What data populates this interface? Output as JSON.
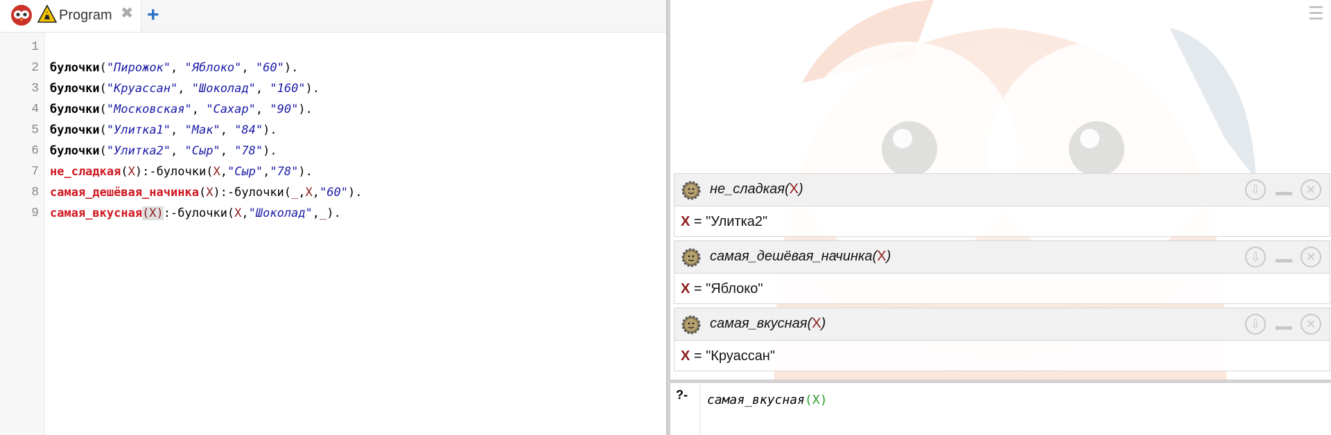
{
  "tab": {
    "title": "Program",
    "close": "✖",
    "new": "+"
  },
  "editor": {
    "line_numbers": [
      "1",
      "2",
      "3",
      "4",
      "5",
      "6",
      "7",
      "8",
      "9"
    ],
    "lines": [
      {
        "tokens": []
      },
      {
        "tokens": [
          {
            "t": "булочки",
            "c": "pr"
          },
          {
            "t": "(",
            "c": "pu"
          },
          {
            "t": "\"Пирожок\"",
            "c": "st"
          },
          {
            "t": ", ",
            "c": "pu"
          },
          {
            "t": "\"Яблоко\"",
            "c": "st"
          },
          {
            "t": ", ",
            "c": "pu"
          },
          {
            "t": "\"60\"",
            "c": "st"
          },
          {
            "t": ").",
            "c": "pu"
          }
        ]
      },
      {
        "tokens": [
          {
            "t": "булочки",
            "c": "pr"
          },
          {
            "t": "(",
            "c": "pu"
          },
          {
            "t": "\"Круассан\"",
            "c": "st"
          },
          {
            "t": ", ",
            "c": "pu"
          },
          {
            "t": "\"Шоколад\"",
            "c": "st"
          },
          {
            "t": ", ",
            "c": "pu"
          },
          {
            "t": "\"160\"",
            "c": "st"
          },
          {
            "t": ").",
            "c": "pu"
          }
        ]
      },
      {
        "tokens": [
          {
            "t": "булочки",
            "c": "pr"
          },
          {
            "t": "(",
            "c": "pu"
          },
          {
            "t": "\"Московская\"",
            "c": "st"
          },
          {
            "t": ", ",
            "c": "pu"
          },
          {
            "t": "\"Сахар\"",
            "c": "st"
          },
          {
            "t": ", ",
            "c": "pu"
          },
          {
            "t": "\"90\"",
            "c": "st"
          },
          {
            "t": ").",
            "c": "pu"
          }
        ]
      },
      {
        "tokens": [
          {
            "t": "булочки",
            "c": "pr"
          },
          {
            "t": "(",
            "c": "pu"
          },
          {
            "t": "\"Улитка1\"",
            "c": "st"
          },
          {
            "t": ", ",
            "c": "pu"
          },
          {
            "t": "\"Мак\"",
            "c": "st"
          },
          {
            "t": ", ",
            "c": "pu"
          },
          {
            "t": "\"84\"",
            "c": "st"
          },
          {
            "t": ").",
            "c": "pu"
          }
        ]
      },
      {
        "tokens": [
          {
            "t": "булочки",
            "c": "pr"
          },
          {
            "t": "(",
            "c": "pu"
          },
          {
            "t": "\"Улитка2\"",
            "c": "st"
          },
          {
            "t": ", ",
            "c": "pu"
          },
          {
            "t": "\"Сыр\"",
            "c": "st"
          },
          {
            "t": ", ",
            "c": "pu"
          },
          {
            "t": "\"78\"",
            "c": "st"
          },
          {
            "t": ").",
            "c": "pu"
          }
        ]
      },
      {
        "tokens": [
          {
            "t": "не_сладкая",
            "c": "hd"
          },
          {
            "t": "(",
            "c": "pu"
          },
          {
            "t": "X",
            "c": "va"
          },
          {
            "t": "):-булочки(",
            "c": "pu"
          },
          {
            "t": "X",
            "c": "va"
          },
          {
            "t": ",",
            "c": "pu"
          },
          {
            "t": "\"Сыр\"",
            "c": "st"
          },
          {
            "t": ",",
            "c": "pu"
          },
          {
            "t": "\"78\"",
            "c": "st"
          },
          {
            "t": ").",
            "c": "pu"
          }
        ]
      },
      {
        "tokens": [
          {
            "t": "самая_дешёвая_начинка",
            "c": "hd"
          },
          {
            "t": "(",
            "c": "pu"
          },
          {
            "t": "X",
            "c": "va"
          },
          {
            "t": "):-булочки(",
            "c": "pu"
          },
          {
            "t": "_",
            "c": "va"
          },
          {
            "t": ",",
            "c": "pu"
          },
          {
            "t": "X",
            "c": "va"
          },
          {
            "t": ",",
            "c": "pu"
          },
          {
            "t": "\"60\"",
            "c": "st"
          },
          {
            "t": ").",
            "c": "pu"
          }
        ]
      },
      {
        "tokens": [
          {
            "t": "самая_вкусная",
            "c": "hd"
          },
          {
            "t": "(X)",
            "c": "va hl"
          },
          {
            "t": ":-булочки(",
            "c": "pu"
          },
          {
            "t": "X",
            "c": "va"
          },
          {
            "t": ",",
            "c": "pu"
          },
          {
            "t": "\"Шоколад\"",
            "c": "st"
          },
          {
            "t": ",",
            "c": "pu"
          },
          {
            "t": "_",
            "c": "va"
          },
          {
            "t": ").",
            "c": "pu"
          }
        ]
      }
    ]
  },
  "results": [
    {
      "query_name": "не_сладкая",
      "query_open": "(",
      "query_var": "X",
      "query_close": ")",
      "res_var": "X",
      "res_eq": " = ",
      "res_value": "\"Улитка2\""
    },
    {
      "query_name": "самая_дешёвая_начинка",
      "query_open": "(",
      "query_var": "X",
      "query_close": ")",
      "res_var": "X",
      "res_eq": " = ",
      "res_value": "\"Яблоко\""
    },
    {
      "query_name": "самая_вкусная",
      "query_open": "(",
      "query_var": "X",
      "query_close": ")",
      "res_var": "X",
      "res_eq": " = ",
      "res_value": "\"Круассан\""
    }
  ],
  "query": {
    "prompt": "?-",
    "name": "самая_вкусная",
    "open": "(",
    "var": "X",
    "close": ")"
  },
  "icons": {
    "menu": "menu-icon",
    "owl": "swish-owl-icon",
    "warning": "warning-icon",
    "gear": "gear-icon",
    "download": "download-icon",
    "minimize": "minimize-icon",
    "close": "close-icon"
  },
  "colors": {
    "head": "#d0161f",
    "string": "#1a1aa6",
    "var": "#8b1a1a",
    "query_paren": "#2a9a2a"
  }
}
